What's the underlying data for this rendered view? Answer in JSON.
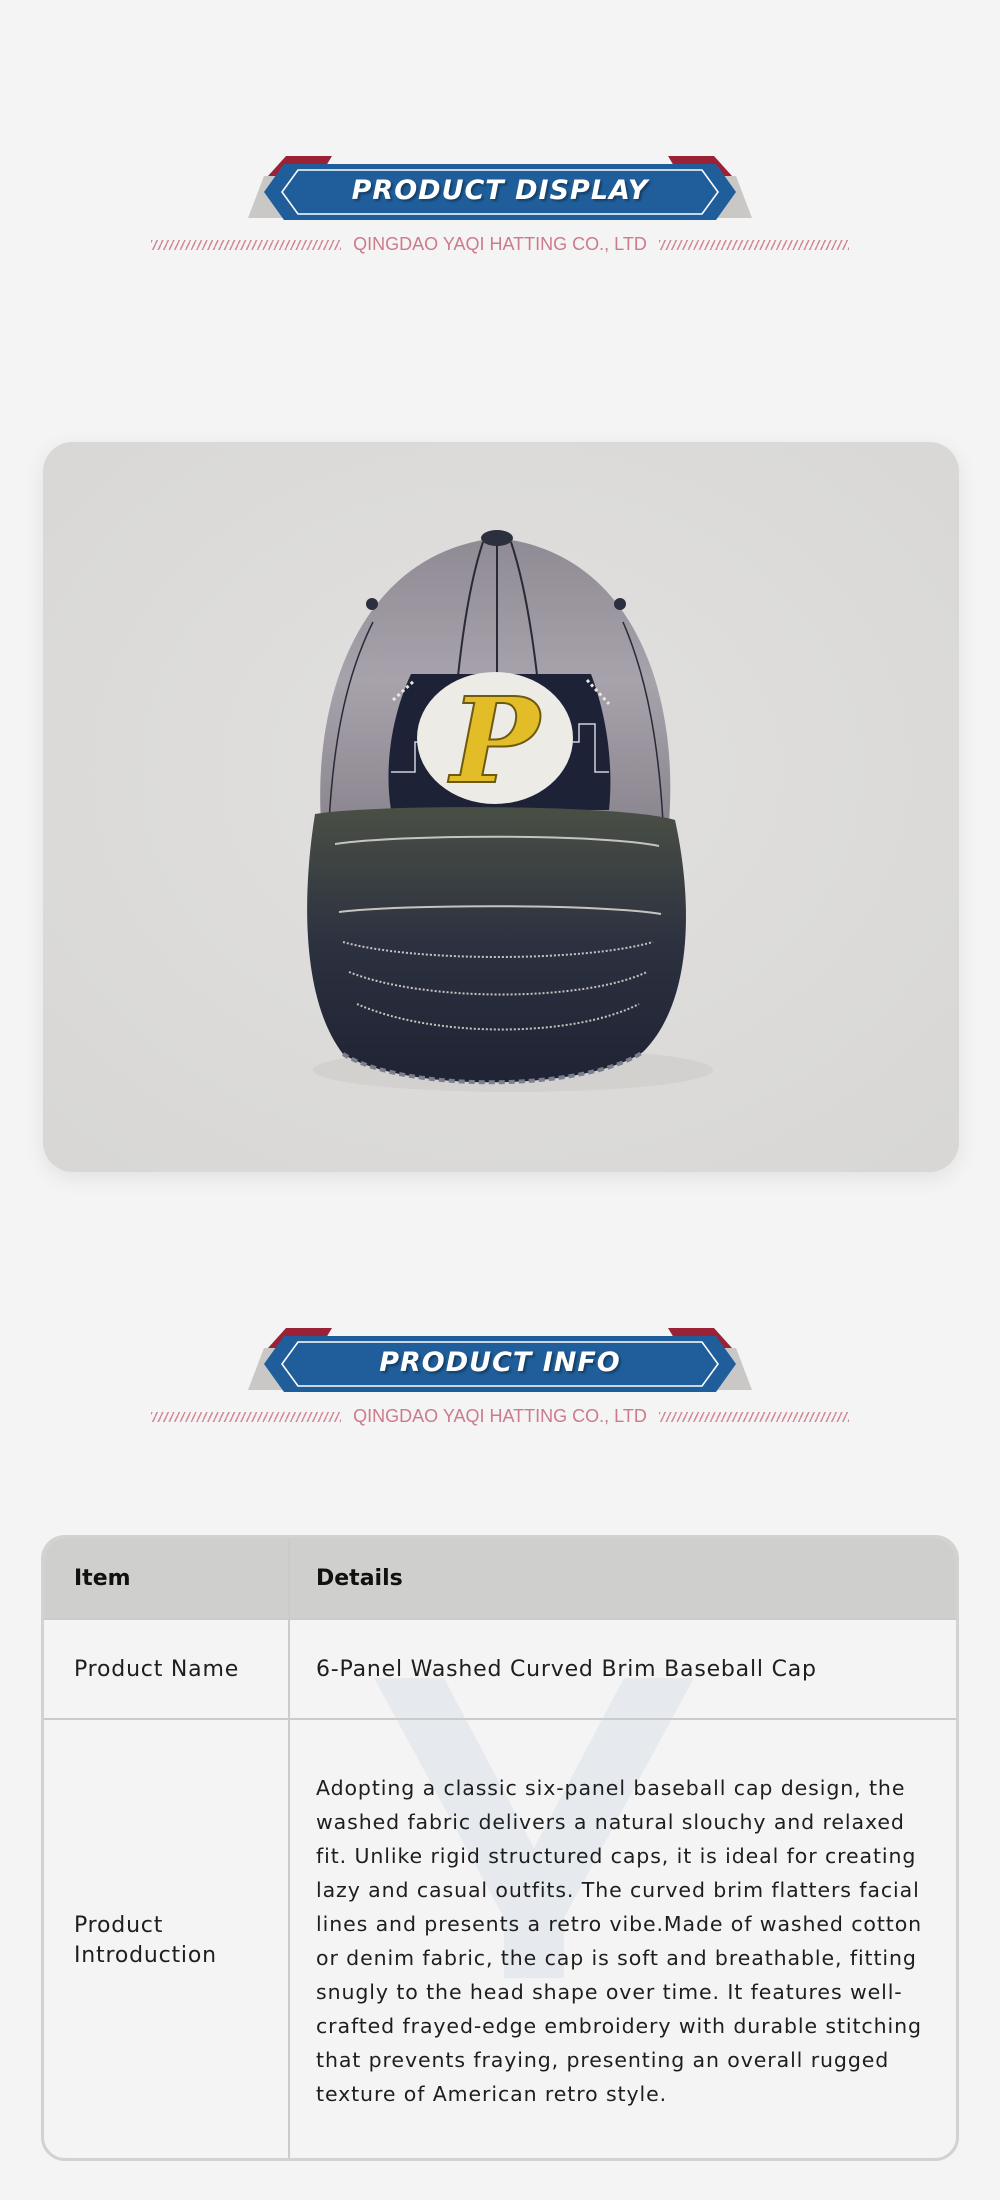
{
  "sections": {
    "display": {
      "title": "PRODUCT DISPLAY",
      "subtitle": "QINGDAO YAQI HATTING CO., LTD"
    },
    "info": {
      "title": "PRODUCT INFO",
      "subtitle": "QINGDAO YAQI HATTING CO., LTD"
    }
  },
  "product_image": {
    "alt": "Distressed washed baseball cap with embroidered P patch",
    "patch_letter": "P"
  },
  "table": {
    "header": {
      "item": "Item",
      "details": "Details"
    },
    "rows": [
      {
        "item": "Product Name",
        "details": "6-Panel Washed Curved Brim Baseball Cap"
      },
      {
        "item": "Product Introduction",
        "details": "Adopting a classic six-panel baseball cap design, the washed fabric delivers a natural slouchy and relaxed fit. Unlike rigid structured caps, it is ideal for creating lazy and casual outfits. The curved brim flatters facial lines and presents a retro vibe.Made of washed cotton or denim fabric, the cap is soft and breathable, fitting snugly to the head shape over time. It features well-crafted frayed-edge embroidery with durable stitching that prevents fraying, presenting an overall rugged texture of American retro style."
      }
    ]
  },
  "colors": {
    "banner_blue": "#1f5e9a",
    "banner_red": "#9b2236",
    "subtitle_pink": "#cc7b8a",
    "page_bg": "#f4f4f4"
  }
}
